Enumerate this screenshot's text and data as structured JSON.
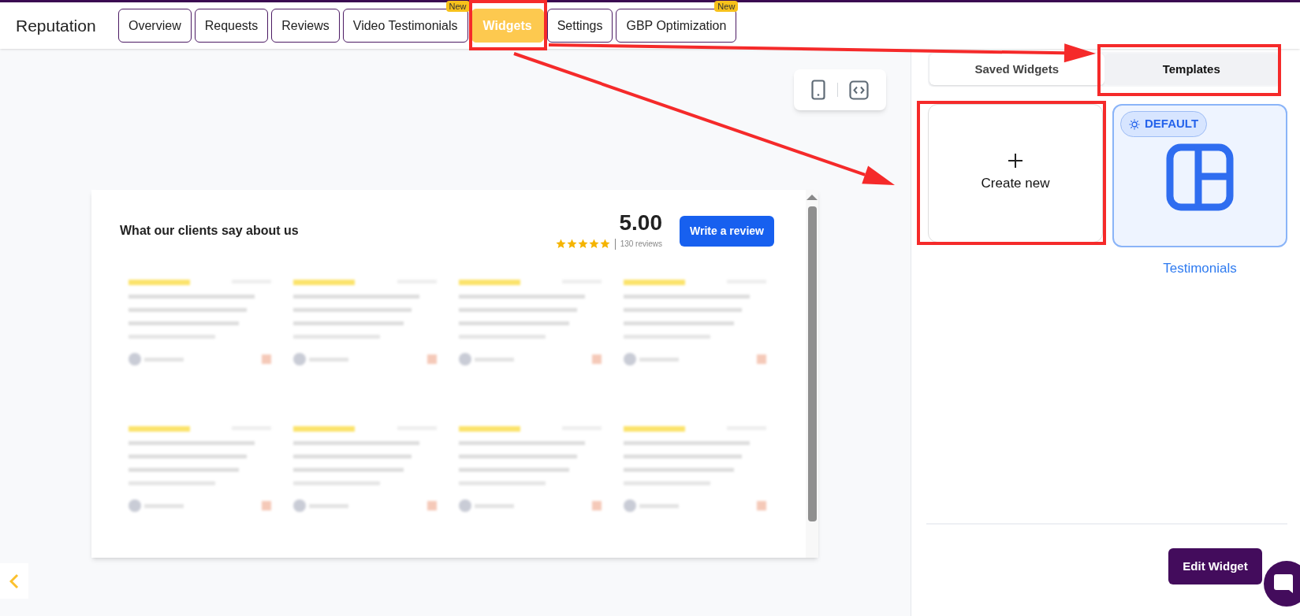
{
  "header": {
    "title": "Reputation"
  },
  "tabs": [
    {
      "label": "Overview",
      "selected": false
    },
    {
      "label": "Requests",
      "selected": false
    },
    {
      "label": "Reviews",
      "selected": false
    },
    {
      "label": "Video Testimonials",
      "selected": false,
      "badge": "New"
    },
    {
      "label": "Widgets",
      "selected": true
    },
    {
      "label": "Settings",
      "selected": false
    },
    {
      "label": "GBP Optimization",
      "selected": false,
      "badge": "New"
    }
  ],
  "widget": {
    "title": "What our clients say about us",
    "rating": "5.00",
    "stars": 5,
    "review_count": "130 reviews",
    "button": "Write a review",
    "review_cards": [
      {
        "kind": "blurred"
      },
      {
        "kind": "blurred"
      },
      {
        "kind": "blurred"
      },
      {
        "kind": "blurred"
      },
      {
        "kind": "blurred"
      },
      {
        "kind": "blurred"
      },
      {
        "kind": "blurred"
      },
      {
        "kind": "blurred"
      }
    ]
  },
  "panel": {
    "tabs": [
      {
        "label": "Saved Widgets",
        "selected": false
      },
      {
        "label": "Templates",
        "selected": true
      }
    ],
    "create_label": "Create new",
    "template": {
      "badge": "DEFAULT",
      "name": "Testimonials"
    },
    "edit_button": "Edit Widget"
  },
  "annotations": [
    {
      "kind": "frame"
    },
    {
      "kind": "frame"
    },
    {
      "kind": "frame"
    },
    {
      "kind": "arrow"
    },
    {
      "kind": "arrow"
    }
  ]
}
